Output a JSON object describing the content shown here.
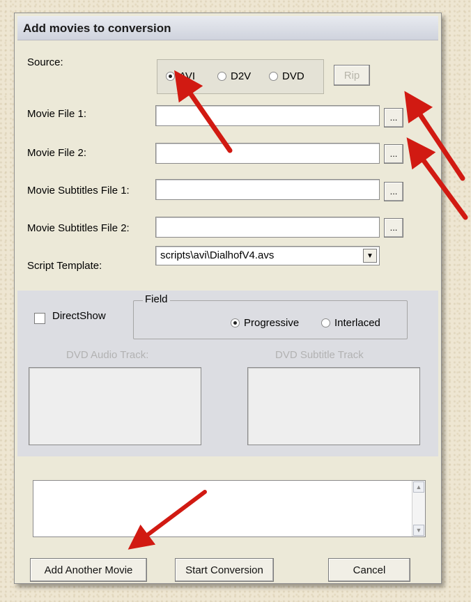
{
  "dialog": {
    "title": "Add movies to conversion"
  },
  "source": {
    "label": "Source:",
    "options": [
      "AVI",
      "D2V",
      "DVD"
    ],
    "selected": "AVI",
    "rip_label": "Rip"
  },
  "fields": {
    "movie_file_1": {
      "label": "Movie File 1:",
      "value": "",
      "browse": "..."
    },
    "movie_file_2": {
      "label": "Movie File 2:",
      "value": "",
      "browse": "..."
    },
    "subtitles_file_1": {
      "label": "Movie Subtitles File 1:",
      "value": "",
      "browse": "..."
    },
    "subtitles_file_2": {
      "label": "Movie Subtitles File 2:",
      "value": "",
      "browse": "..."
    }
  },
  "script_template": {
    "label": "Script Template:",
    "value": "scripts\\avi\\DialhofV4.avs"
  },
  "directshow": {
    "label": "DirectShow",
    "checked": false
  },
  "field_group": {
    "title": "Field",
    "options": [
      "Progressive",
      "Interlaced"
    ],
    "selected": "Progressive"
  },
  "dvd": {
    "audio_label": "DVD Audio Track:",
    "subtitle_label": "DVD Subtitle Track"
  },
  "buttons": {
    "add_another": "Add Another Movie",
    "start": "Start Conversion",
    "cancel": "Cancel"
  },
  "colors": {
    "dialog_bg": "#ece9d8",
    "annotation_arrow": "#d11a12"
  }
}
